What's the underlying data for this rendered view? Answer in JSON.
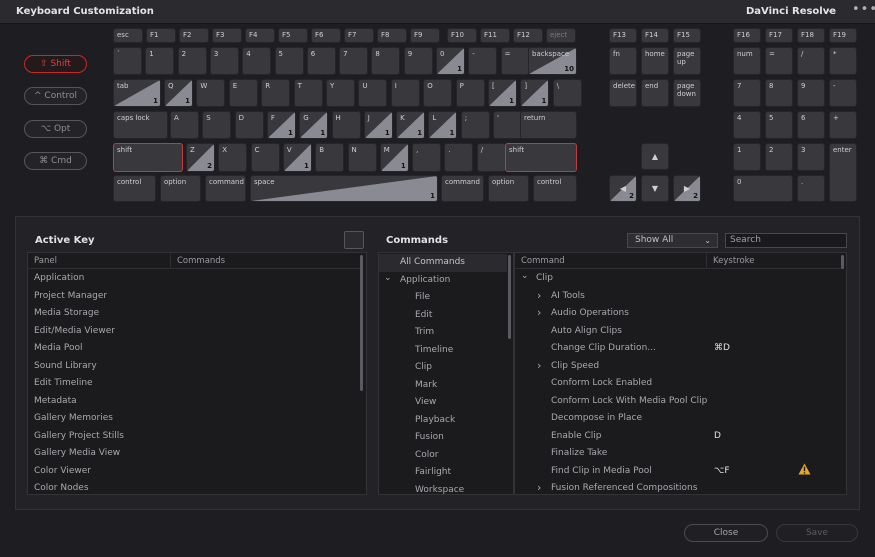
{
  "window": {
    "title": "Keyboard Customization",
    "preset": "DaVinci Resolve",
    "more_label": "•••"
  },
  "modifiers": [
    {
      "label": "⇧ Shift",
      "active": true
    },
    {
      "label": "^ Control",
      "active": false
    },
    {
      "label": "⌥ Opt",
      "active": false
    },
    {
      "label": "⌘ Cmd",
      "active": false
    }
  ],
  "keyboard": {
    "fn_row": [
      {
        "label": "esc"
      },
      {
        "label": "F1"
      },
      {
        "label": "F2"
      },
      {
        "label": "F3"
      },
      {
        "label": "F4"
      },
      {
        "label": "F5"
      },
      {
        "label": "F6"
      },
      {
        "label": "F7"
      },
      {
        "label": "F8"
      },
      {
        "label": "F9"
      },
      {
        "label": "F10"
      },
      {
        "label": "F11"
      },
      {
        "label": "F12"
      },
      {
        "label": "eject"
      },
      {
        "label": "F13"
      },
      {
        "label": "F14"
      },
      {
        "label": "F15"
      },
      {
        "label": "F16"
      },
      {
        "label": "F17"
      },
      {
        "label": "F18"
      },
      {
        "label": "F19"
      }
    ],
    "number_row": [
      {
        "label": "`",
        "count": ""
      },
      {
        "label": "1",
        "count": ""
      },
      {
        "label": "2",
        "count": ""
      },
      {
        "label": "3",
        "count": ""
      },
      {
        "label": "4",
        "count": ""
      },
      {
        "label": "5",
        "count": ""
      },
      {
        "label": "6",
        "count": ""
      },
      {
        "label": "7",
        "count": ""
      },
      {
        "label": "8",
        "count": ""
      },
      {
        "label": "9",
        "count": ""
      },
      {
        "label": "0",
        "count": "1"
      },
      {
        "label": "-",
        "count": ""
      },
      {
        "label": "=",
        "count": ""
      },
      {
        "label": "backspace",
        "count": "10"
      }
    ],
    "tab_row": [
      {
        "label": "tab",
        "count": "1"
      },
      {
        "label": "Q",
        "count": "1"
      },
      {
        "label": "W",
        "count": ""
      },
      {
        "label": "E",
        "count": ""
      },
      {
        "label": "R",
        "count": ""
      },
      {
        "label": "T",
        "count": ""
      },
      {
        "label": "Y",
        "count": ""
      },
      {
        "label": "U",
        "count": ""
      },
      {
        "label": "I",
        "count": ""
      },
      {
        "label": "O",
        "count": ""
      },
      {
        "label": "P",
        "count": ""
      },
      {
        "label": "[",
        "count": "1"
      },
      {
        "label": "]",
        "count": "1"
      },
      {
        "label": "\\",
        "count": ""
      }
    ],
    "caps_row": [
      {
        "label": "caps lock",
        "count": ""
      },
      {
        "label": "A",
        "count": ""
      },
      {
        "label": "S",
        "count": ""
      },
      {
        "label": "D",
        "count": ""
      },
      {
        "label": "F",
        "count": "1"
      },
      {
        "label": "G",
        "count": "1"
      },
      {
        "label": "H",
        "count": ""
      },
      {
        "label": "J",
        "count": "1"
      },
      {
        "label": "K",
        "count": "1"
      },
      {
        "label": "L",
        "count": "1"
      },
      {
        "label": ";",
        "count": ""
      },
      {
        "label": "'",
        "count": ""
      },
      {
        "label": "return",
        "count": ""
      }
    ],
    "shift_row": [
      {
        "label": "shift",
        "count": ""
      },
      {
        "label": "Z",
        "count": "2"
      },
      {
        "label": "X",
        "count": ""
      },
      {
        "label": "C",
        "count": ""
      },
      {
        "label": "V",
        "count": "1"
      },
      {
        "label": "B",
        "count": ""
      },
      {
        "label": "N",
        "count": ""
      },
      {
        "label": "M",
        "count": "1"
      },
      {
        "label": ",",
        "count": ""
      },
      {
        "label": ".",
        "count": ""
      },
      {
        "label": "/",
        "count": ""
      },
      {
        "label": "shift",
        "count": ""
      }
    ],
    "bottom_row": [
      {
        "label": "control",
        "count": ""
      },
      {
        "label": "option",
        "count": ""
      },
      {
        "label": "command",
        "count": ""
      },
      {
        "label": "space",
        "count": "1"
      },
      {
        "label": "command",
        "count": ""
      },
      {
        "label": "option",
        "count": ""
      },
      {
        "label": "control",
        "count": ""
      }
    ],
    "nav_keys": [
      {
        "label": "fn",
        "count": ""
      },
      {
        "label": "home",
        "count": ""
      },
      {
        "label": "page\nup",
        "count": ""
      },
      {
        "label": "delete",
        "count": ""
      },
      {
        "label": "end",
        "count": ""
      },
      {
        "label": "page\ndown",
        "count": ""
      }
    ],
    "arrows": [
      {
        "label": "▲",
        "count": ""
      },
      {
        "label": "◀",
        "count": "2"
      },
      {
        "label": "▼",
        "count": ""
      },
      {
        "label": "▶",
        "count": "2"
      }
    ],
    "numpad": [
      {
        "label": "num",
        "count": ""
      },
      {
        "label": "=",
        "count": ""
      },
      {
        "label": "/",
        "count": ""
      },
      {
        "label": "*",
        "count": ""
      },
      {
        "label": "7",
        "count": ""
      },
      {
        "label": "8",
        "count": ""
      },
      {
        "label": "9",
        "count": ""
      },
      {
        "label": "-",
        "count": ""
      },
      {
        "label": "4",
        "count": ""
      },
      {
        "label": "5",
        "count": ""
      },
      {
        "label": "6",
        "count": ""
      },
      {
        "label": "+",
        "count": ""
      },
      {
        "label": "1",
        "count": ""
      },
      {
        "label": "2",
        "count": ""
      },
      {
        "label": "3",
        "count": ""
      },
      {
        "label": "enter",
        "count": ""
      },
      {
        "label": "0",
        "count": ""
      },
      {
        "label": ".",
        "count": ""
      }
    ]
  },
  "active_key": {
    "title": "Active Key",
    "columns": [
      "Panel",
      "Commands"
    ],
    "rows": [
      "Application",
      "Project Manager",
      "Media Storage",
      "Edit/Media Viewer",
      "Media Pool",
      "Sound Library",
      "Edit Timeline",
      "Metadata",
      "Gallery Memories",
      "Gallery Project Stills",
      "Gallery Media View",
      "Color Viewer",
      "Color Nodes"
    ]
  },
  "commands": {
    "title": "Commands",
    "filter": "Show All",
    "search_placeholder": "Search",
    "tree": [
      {
        "label": "All Commands",
        "level": 0,
        "arrow": ""
      },
      {
        "label": "Application",
        "level": 0,
        "arrow": "⌄"
      },
      {
        "label": "File",
        "level": 1,
        "arrow": ""
      },
      {
        "label": "Edit",
        "level": 1,
        "arrow": ""
      },
      {
        "label": "Trim",
        "level": 1,
        "arrow": ""
      },
      {
        "label": "Timeline",
        "level": 1,
        "arrow": ""
      },
      {
        "label": "Clip",
        "level": 1,
        "arrow": ""
      },
      {
        "label": "Mark",
        "level": 1,
        "arrow": ""
      },
      {
        "label": "View",
        "level": 1,
        "arrow": ""
      },
      {
        "label": "Playback",
        "level": 1,
        "arrow": ""
      },
      {
        "label": "Fusion",
        "level": 1,
        "arrow": ""
      },
      {
        "label": "Color",
        "level": 1,
        "arrow": ""
      },
      {
        "label": "Fairlight",
        "level": 1,
        "arrow": ""
      },
      {
        "label": "Workspace",
        "level": 1,
        "arrow": ""
      }
    ],
    "columns": [
      "Command",
      "Keystroke"
    ],
    "rows": [
      {
        "command": "Clip",
        "keystroke": "",
        "arrow": "⌄",
        "level": 0
      },
      {
        "command": "AI Tools",
        "keystroke": "",
        "arrow": "›",
        "level": 1
      },
      {
        "command": "Audio Operations",
        "keystroke": "",
        "arrow": "›",
        "level": 1
      },
      {
        "command": "Auto Align Clips",
        "keystroke": "",
        "arrow": "",
        "level": 1
      },
      {
        "command": "Change Clip Duration...",
        "keystroke": "⌘D",
        "arrow": "",
        "level": 1
      },
      {
        "command": "Clip Speed",
        "keystroke": "",
        "arrow": "›",
        "level": 1
      },
      {
        "command": "Conform Lock Enabled",
        "keystroke": "",
        "arrow": "",
        "level": 1
      },
      {
        "command": "Conform Lock With Media Pool Clip",
        "keystroke": "",
        "arrow": "",
        "level": 1
      },
      {
        "command": "Decompose in Place",
        "keystroke": "",
        "arrow": "",
        "level": 1
      },
      {
        "command": "Enable Clip",
        "keystroke": "D",
        "arrow": "",
        "level": 1
      },
      {
        "command": "Finalize Take",
        "keystroke": "",
        "arrow": "",
        "level": 1
      },
      {
        "command": "Find Clip in Media Pool",
        "keystroke": "⌥F",
        "arrow": "",
        "level": 1
      },
      {
        "command": "Fusion Referenced Compositions",
        "keystroke": "",
        "arrow": "›",
        "level": 1
      }
    ]
  },
  "footer": {
    "close_label": "Close",
    "save_label": "Save"
  },
  "colors": {
    "accent_red": "#c82828",
    "warning": "#e8a825"
  }
}
